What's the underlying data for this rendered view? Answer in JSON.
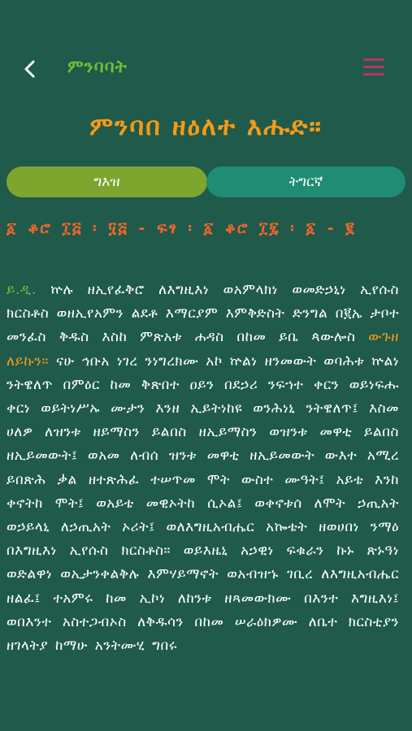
{
  "header": {
    "back_icon": "chevron-left-icon",
    "title": "ምንባባት",
    "menu_icon": "hamburger-menu-icon"
  },
  "page": {
    "title": "ምንባበ ዘዕለተ እሑድ።"
  },
  "tabs": [
    {
      "label": "ግእዝ",
      "selected": true
    },
    {
      "label": "ትግርኛ",
      "selected": false
    }
  ],
  "verse_reference": "፩ ቆሮ ፲፭ ፡ ፶፭ - ፍፃ ፡ ፩ ቆሮ ፲፯ ፡ ፩ - ፪",
  "body": {
    "lead": "ይ.ዲ.",
    "text_part1": "ኵሉ ዘኢየፈቅሮ ለእግዚእነ ወአምላክነ ወመድኃኒነ ኢየሱስ ክርስቶስ ወዘኢየአምን ልደቶ እማርያም እምቅድስት ድንግል በ፪ኤ ታቦተ መንፈስ ቅዱስ እስከ ምጽአቱ ሐዳስ በከመ ይቤ ጳውሎስ ",
    "inline_title": "ውጉዘ ለይኩን።",
    "text_part2": " ናሁ ኅቡአ ነገረ ንነግረክሙ አኮ ኵልነ ዘንመውት ወባሕቱ ኵልነ ንትዌለጥ በምዕር ከመ ቅጽበተ ዐይን በደኃሪ ንፍኀተ ቀርን ወይነፍሑ ቀርነ ወይትነሥኡ ሙታን እንዘ ኢይትነከዩ ወንሕነኒ ንትዌለጥ፤ እስመ ሀለዎ ለዝንቱ ዘይማስን ይልበስ ዘኢይማስን ወዝንቱ መዋቲ ይልበስ ዘኢይመውት፤ ወአመ ለብሰ ዝንቱ መዋቲ ዘኢይመውት ውእተ አሚረ ይበጽሕ ቃል ዘተጽሕፈ ተሠጥመ ሞት ውስተ ሙዓት፤ አይቴ እንከ ቀኖትከ ሞት፤ ወአይቴ መዊኦትከ ሲኦል፤ ወቀኖቱሰ ለሞት ኃጢአት ወኃይላኒ ለኃጢአት ኦሪት፤ ወለእግዚአብሔር አኰቴት ዘወሀበነ ንማዕ በእግዚእነ ኢየሱስ ክርስቶስ። ወይእዜኒ አኃዊነ ፍቁራን ኩኑ ጽኑዓነ ወድልዋነ ወኢታንቀልቅሉ እምሃይማኖት ወአብዝኁ ገቢረ ለእግዚአብሔር ዘልፈ፤ ተአምሩ ከመ ኢኮነ ለከንቱ ዘጻመውክሙ በእንተ እግዚእነ፤ ወበእንተ አስተጋብኦስ ለቅዱሳን በከመ ሠራዕክዎሙ ለቤተ ክርስቲያን ዘገላትያ ከማሁ አንትሙሂ ግበሩ"
  },
  "colors": {
    "background": "#1f5a4b",
    "accent_green": "#6cbf3a",
    "accent_orange": "#f59a17",
    "accent_red_orange": "#f2662b",
    "menu_magenta": "#c0306a",
    "tab_selected": "#7ea52e",
    "tab_unselected": "#1f8c73"
  }
}
